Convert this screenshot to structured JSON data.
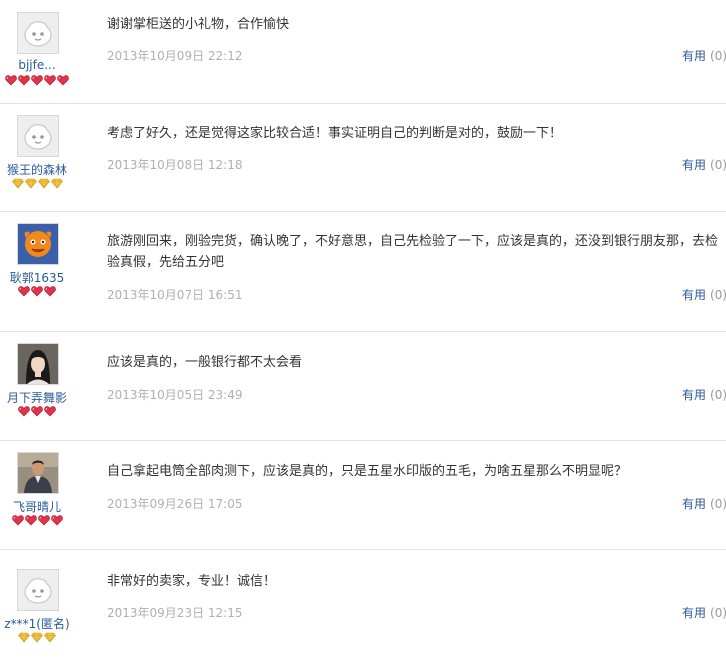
{
  "colors": {
    "link": "#2a5a9c",
    "date": "#b0b0b0",
    "divider": "#e3e3e3",
    "heart_rank": "#e0334c",
    "diamond_rank": "#f4c542"
  },
  "reviews": [
    {
      "username": "bjjfe...",
      "avatar": "default-face-avatar",
      "rank_icon": "red-heart-icon",
      "rank_count": 5,
      "content": "谢谢掌柜送的小礼物，合作愉快",
      "date": "2013年10月09日 22:12",
      "useful_label": "有用",
      "useful_count": "(0)"
    },
    {
      "username": "猴王的森林",
      "avatar": "default-face-avatar",
      "rank_icon": "yellow-diamond-icon",
      "rank_count": 4,
      "content": "考虑了好久，还是觉得这家比较合适！事实证明自己的判断是对的，鼓励一下！",
      "date": "2013年10月08日 12:18",
      "useful_label": "有用",
      "useful_count": "(0)"
    },
    {
      "username": "耿郭1635",
      "avatar": "orange-character-avatar",
      "rank_icon": "red-heart-icon",
      "rank_count": 3,
      "content": "旅游刚回来，刚验完货，确认晚了，不好意思，自己先检验了一下，应该是真的，还没到银行朋友那，去检验真假，先给五分吧",
      "date": "2013年10月07日 16:51",
      "useful_label": "有用",
      "useful_count": "(0)"
    },
    {
      "username": "月下弄舞影",
      "avatar": "woman-photo-avatar",
      "rank_icon": "red-heart-icon",
      "rank_count": 3,
      "content": "应该是真的，一般银行都不太会看",
      "date": "2013年10月05日 23:49",
      "useful_label": "有用",
      "useful_count": "(0)"
    },
    {
      "username": "飞哥晴儿",
      "avatar": "man-photo-avatar",
      "rank_icon": "red-heart-icon",
      "rank_count": 4,
      "content": "自己拿起电筒全部肉测下，应该是真的，只是五星水印版的五毛，为啥五星那么不明显呢？",
      "date": "2013年09月26日 17:05",
      "useful_label": "有用",
      "useful_count": "(0)"
    },
    {
      "username": "z***1(匿名)",
      "avatar": "default-face-avatar",
      "rank_icon": "yellow-diamond-icon",
      "rank_count": 3,
      "content": "非常好的卖家，专业！诚信！",
      "date": "2013年09月23日 12:15",
      "useful_label": "有用",
      "useful_count": "(0)"
    }
  ]
}
